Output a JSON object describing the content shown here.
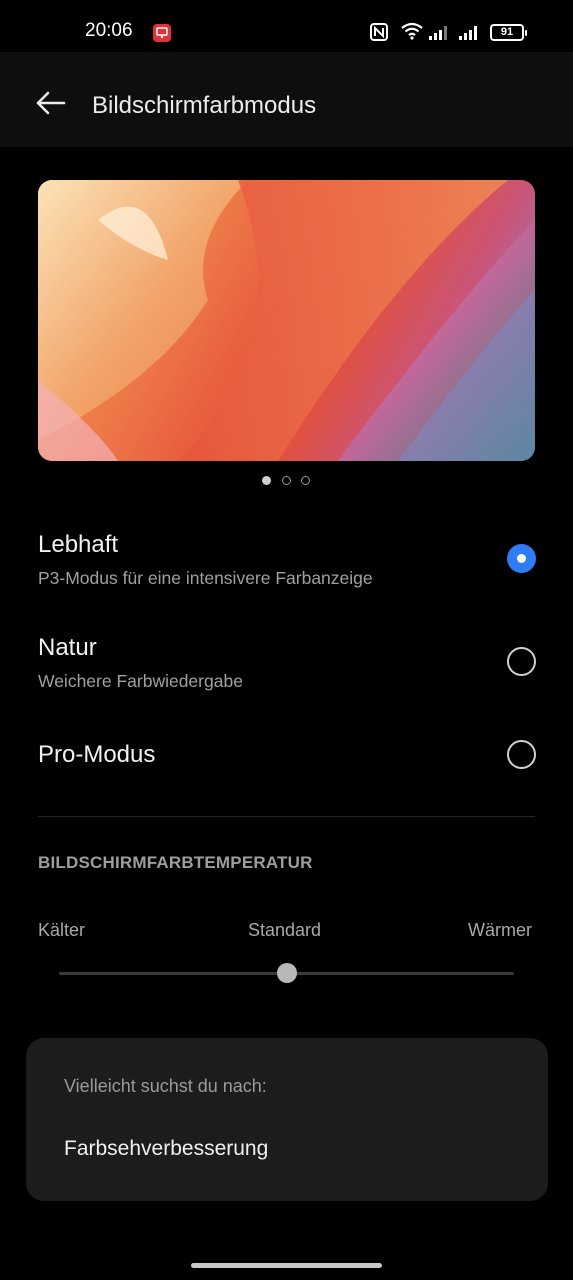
{
  "status_bar": {
    "time": "20:06",
    "battery": "91",
    "icons": [
      "screen-record-icon",
      "nfc-icon",
      "wifi-icon",
      "signal-icon",
      "signal-icon",
      "battery-icon"
    ]
  },
  "header": {
    "title": "Bildschirmfarbmodus",
    "back_icon": "arrow-left-icon"
  },
  "preview": {
    "pages": 3,
    "active_page": 1
  },
  "options": [
    {
      "title": "Lebhaft",
      "subtitle": "P3-Modus für eine intensivere Farbanzeige",
      "selected": true
    },
    {
      "title": "Natur",
      "subtitle": "Weichere Farbwiedergabe",
      "selected": false
    },
    {
      "title": "Pro-Modus",
      "subtitle": "",
      "selected": false
    }
  ],
  "temperature": {
    "section_title": "BILDSCHIRMFARBTEMPERATUR",
    "label_left": "Kälter",
    "label_center": "Standard",
    "label_right": "Wärmer",
    "value_fraction": 0.5
  },
  "suggestion": {
    "title": "Vielleicht suchst du nach:",
    "item": "Farbsehverbesserung"
  },
  "colors": {
    "accent": "#2f7cf6",
    "background": "#000000",
    "card": "#1c1c1c"
  }
}
